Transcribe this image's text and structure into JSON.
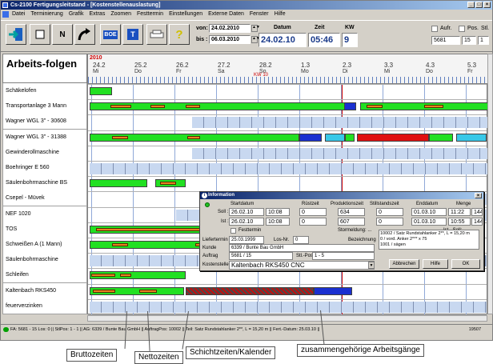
{
  "window": {
    "title": "Cs-2100 Fertigungsleitstand - [Kostenstellenauslastung]"
  },
  "menu": [
    "Datei",
    "Terminierung",
    "Grafik",
    "Extras",
    "Zoomen",
    "Festtermin",
    "Einstellungen",
    "Externe Daten",
    "Fenster",
    "Hilfe"
  ],
  "toolbar": {
    "von_label": "von:",
    "von_value": "24.02.2010",
    "bis_label": "bis :",
    "bis_value": "06.03.2010",
    "datum_label": "Datum",
    "datum_value": "24.02.10",
    "zeit_label": "Zeit",
    "zeit_value": "05:46",
    "kw_label": "KW",
    "kw_value": "9",
    "btn_boe": "BOE",
    "btn_t": "T",
    "btn_n": "N",
    "aufr_label": "Aufr.",
    "pos_label": "Pos.",
    "stl_label": "Stl.",
    "auftrag_value": "5681",
    "pos_value": "15",
    "extra_value": "1"
  },
  "gantt": {
    "header_title": "Arbeits-folgen",
    "year": "2010",
    "kw_marker": "KW 10",
    "dates": [
      {
        "d": "24.2",
        "w": "Mi"
      },
      {
        "d": "25.2",
        "w": "Do"
      },
      {
        "d": "26.2",
        "w": "Fr"
      },
      {
        "d": "27.2",
        "w": "Sa"
      },
      {
        "d": "28.2",
        "w": "So"
      },
      {
        "d": "1.3",
        "w": "Mo"
      },
      {
        "d": "2.3",
        "w": "Di"
      },
      {
        "d": "3.3",
        "w": "Mi"
      },
      {
        "d": "4.3",
        "w": "Do"
      },
      {
        "d": "5.3",
        "w": "Fr"
      }
    ],
    "rows": [
      "Schäkelofen",
      "Transportanlage  3 Mann",
      "Wagner WGL 3\" - 30608",
      "Wagner WGL 3\" - 31388",
      "Gewinderollmaschine",
      "Boehringer E 560",
      "Säulenbohrmaschine BS",
      "Csepel - Müvek",
      "NEF 1020",
      "TOS",
      "Schweißen A (1 Mann)",
      "Säulenbohrmaschine",
      "Schleifen",
      "Kaltenbach RKS450",
      "feuerverzinken"
    ]
  },
  "dialog": {
    "title": "Information",
    "col_startdatum": "Startdatum",
    "col_ruestzeit": "Rüstzeit",
    "col_produktionszeit": "Produktionszeit",
    "col_stillstandszeit": "Stillstandszeit",
    "col_enddatum": "Enddatum",
    "col_menge": "Menge",
    "soll_label": "Soll :",
    "soll_start": "26.02.10",
    "soll_start_time": "10:08",
    "soll_ruest": "0",
    "soll_prod": "634",
    "soll_still": "0",
    "soll_end": "01.03.10",
    "soll_end_time": "11:22",
    "soll_menge": "144",
    "ist_label": "Ist :",
    "ist_start": "26.02.10",
    "ist_start_time": "10:08",
    "ist_ruest": "0",
    "ist_prod": "607",
    "ist_still": "0",
    "ist_end": "01.03.10",
    "ist_end_time": "10:55",
    "ist_menge": "144",
    "festtermin_label": "Festtermin",
    "stormeldung_label": "Stormeldung: ...",
    "ist_soll_label": "Ist - Soll:",
    "liefertermin_label": "Liefertermin",
    "liefertermin_value": "25.03.1999",
    "losnr_label": "Los-Nr.",
    "losnr_value": "0",
    "bezeichnung_label": "Bezeichnung",
    "bezeichnung_lines": [
      "10002 / Satz Rundstahlanker 2**, L = 15,20 m",
      "0 / vord. Anker 2*** x 75",
      "1001 / sägen"
    ],
    "kunde_label": "Kunde",
    "kunde_value": "6339 / Bunte Bau GmbH",
    "auftrag_label": "Auftrag",
    "auftrag_value": "5681 / 15",
    "stlpos_label": "Stl.-Pos",
    "stlpos_value": "1 - 5",
    "kostenstelle_label": "Kostenstelle",
    "kostenstelle_value": "Kaltenbach RKS450 CNC",
    "abbrechen": "Abbrechen",
    "hilfe": "Hilfe",
    "ok": "OK"
  },
  "statusbar": {
    "text": "FA: 5681 - 15 Los: 0 ||  StlPos: 1 - 1 ||  AG: 6339 / Bunte Bau GmbH ||  AuftragPos: 10002 ||  Teil: Satz Rundstahlanker 2**, L = 15,20 m ||  Fert.-Datum: 25.03.10  ||",
    "right": "19507"
  },
  "annotations": {
    "brutto": "Bruttozeiten",
    "netto": "Nettozeiten",
    "schicht": "Schichtzeiten/Kalender",
    "zusammen": "zusammengehörige Arbeitsgänge"
  },
  "colors": {
    "green": "#22e022",
    "blue": "#1a30d0",
    "cyan": "#38c8e8",
    "red": "#e01010",
    "orange": "#e88020"
  }
}
